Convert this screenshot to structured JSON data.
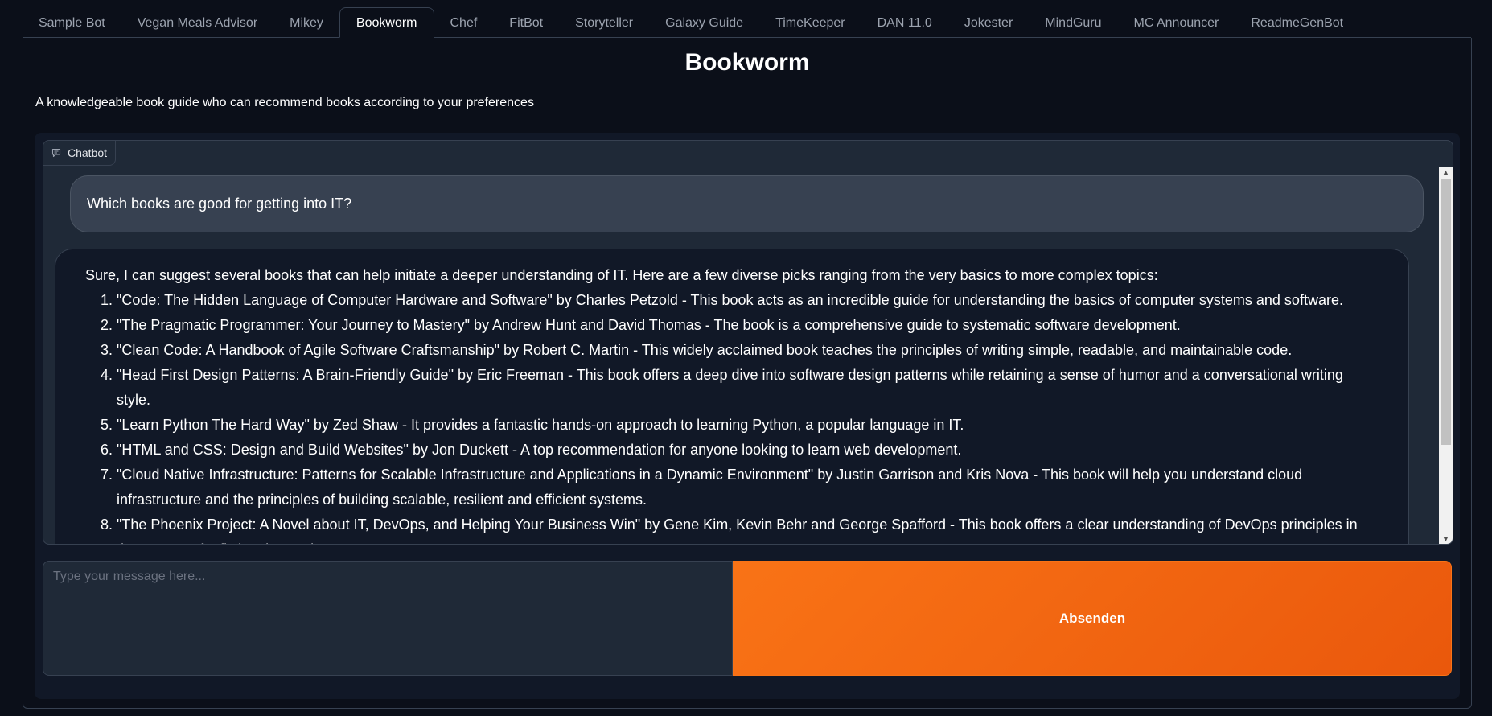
{
  "tabs": [
    {
      "label": "Sample Bot"
    },
    {
      "label": "Vegan Meals Advisor"
    },
    {
      "label": "Mikey"
    },
    {
      "label": "Bookworm",
      "active": true
    },
    {
      "label": "Chef"
    },
    {
      "label": "FitBot"
    },
    {
      "label": "Storyteller"
    },
    {
      "label": "Galaxy Guide"
    },
    {
      "label": "TimeKeeper"
    },
    {
      "label": "DAN 11.0"
    },
    {
      "label": "Jokester"
    },
    {
      "label": "MindGuru"
    },
    {
      "label": "MC Announcer"
    },
    {
      "label": "ReadmeGenBot"
    }
  ],
  "page": {
    "title": "Bookworm",
    "description": "A knowledgeable book guide who can recommend books according to your preferences"
  },
  "chatbot": {
    "label": "Chatbot",
    "icon": "chat-icon",
    "user_message": "Which books are good for getting into IT?",
    "bot_intro": "Sure, I can suggest several books that can help initiate a deeper understanding of IT. Here are a few diverse picks ranging from the very basics to more complex topics:",
    "bot_items": [
      "\"Code: The Hidden Language of Computer Hardware and Software\" by Charles Petzold - This book acts as an incredible guide for understanding the basics of computer systems and software.",
      "\"The Pragmatic Programmer: Your Journey to Mastery\" by Andrew Hunt and David Thomas - The book is a comprehensive guide to systematic software development.",
      "\"Clean Code: A Handbook of Agile Software Craftsmanship\" by Robert C. Martin - This widely acclaimed book teaches the principles of writing simple, readable, and maintainable code.",
      "\"Head First Design Patterns: A Brain-Friendly Guide\" by Eric Freeman - This book offers a deep dive into software design patterns while retaining a sense of humor and a conversational writing style.",
      "\"Learn Python The Hard Way\" by Zed Shaw - It provides a fantastic hands-on approach to learning Python, a popular language in IT.",
      "\"HTML and CSS: Design and Build Websites\" by Jon Duckett - A top recommendation for anyone looking to learn web development.",
      "\"Cloud Native Infrastructure: Patterns for Scalable Infrastructure and Applications in a Dynamic Environment\" by Justin Garrison and Kris Nova - This book will help you understand cloud infrastructure and the principles of building scalable, resilient and efficient systems.",
      "\"The Phoenix Project: A Novel about IT, DevOps, and Helping Your Business Win\" by Gene Kim, Kevin Behr and George Spafford - This book offers a clear understanding of DevOps principles in the context of a fictional narrative."
    ]
  },
  "input": {
    "placeholder": "Type your message here...",
    "value": ""
  },
  "send_button": {
    "label": "Absenden"
  },
  "colors": {
    "background": "#0b0f19",
    "accent": "#f97316",
    "panel": "#1f2937"
  }
}
